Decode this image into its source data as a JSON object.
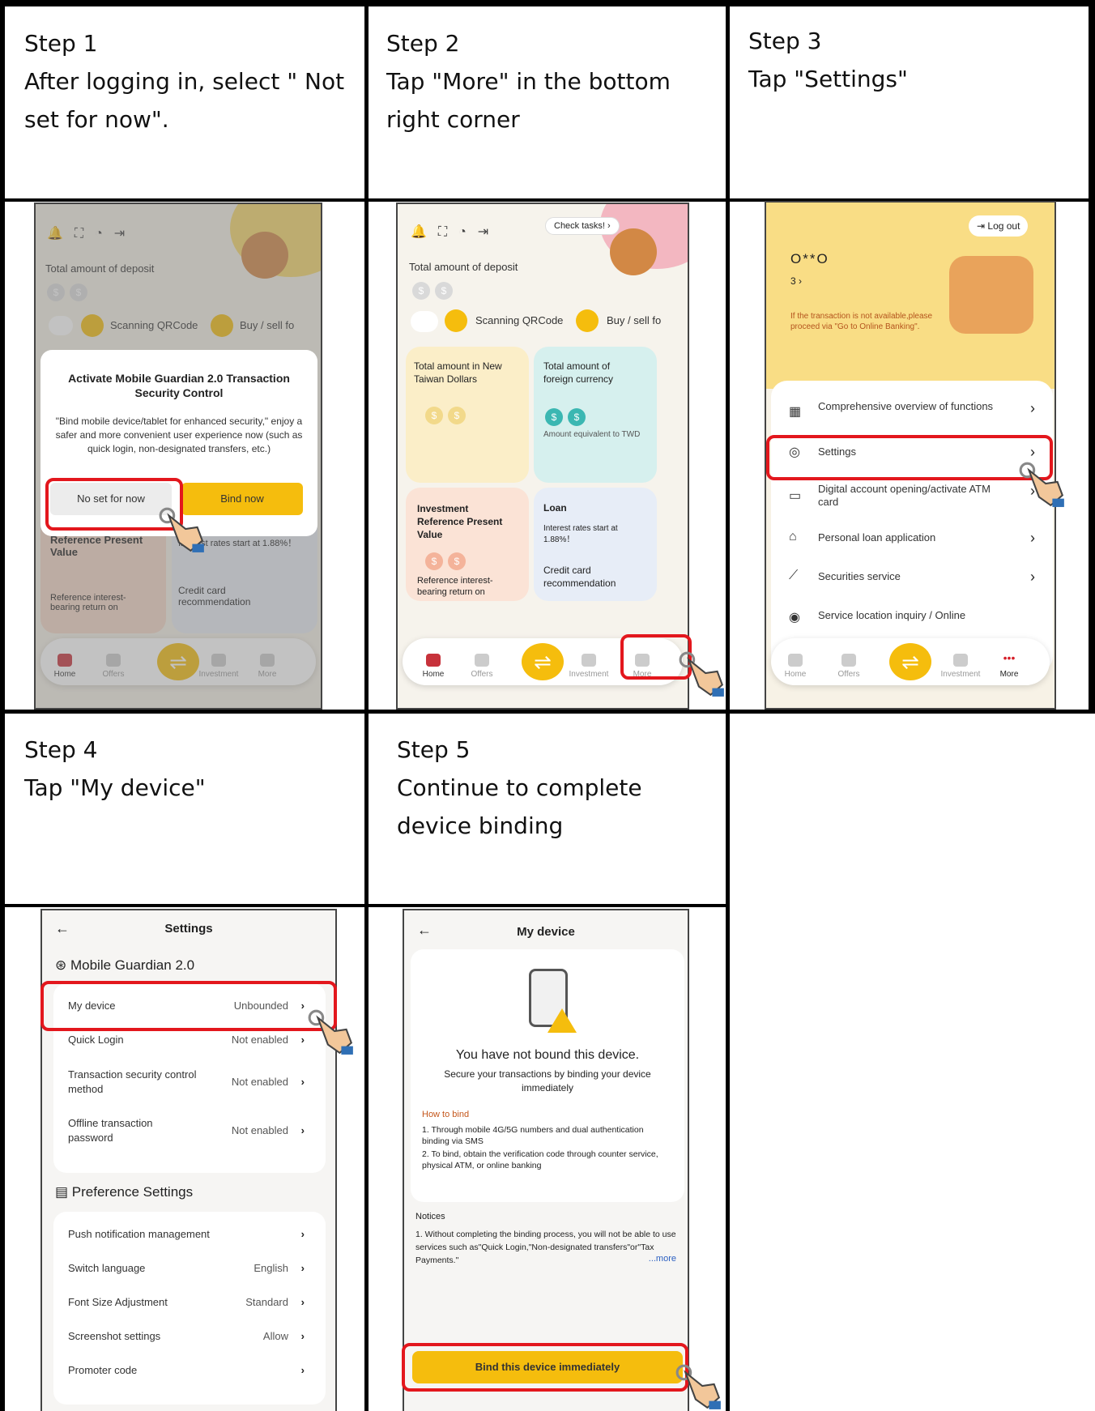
{
  "steps": [
    {
      "title": "Step 1",
      "desc": "After logging in, select \" Not set for now\"."
    },
    {
      "title": "Step 2",
      "desc": "Tap \"More\" in the bottom right corner"
    },
    {
      "title": "Step 3",
      "desc": "Tap \"Settings\""
    },
    {
      "title": "Step 4",
      "desc": "Tap \"My device\""
    },
    {
      "title": "Step 5",
      "desc": "Continue to complete device binding"
    }
  ],
  "home": {
    "deposit_label": "Total amount of deposit",
    "scan_label": "Scanning QRCode",
    "buysell_label": "Buy / sell fo",
    "check_tasks": "Check tasks! ›",
    "card_twd": "Total amount in New Taiwan Dollars",
    "card_foreign": "Total amount of foreign currency",
    "card_foreign_sub": "Amount equivalent to TWD",
    "card_invest": "Investment Reference Present Value",
    "card_invest_sub": "Reference interest-bearing return on",
    "card_loan": "Loan",
    "card_loan_sub": "Interest rates start at 1.88%！",
    "card_credit": "Credit card recommendation",
    "nav": {
      "home": "Home",
      "offers": "Offers",
      "investment": "Investment",
      "more": "More"
    }
  },
  "dialog": {
    "title": "Activate Mobile Guardian 2.0 Transaction Security Control",
    "body": "\"Bind mobile device/tablet for enhanced security,\" enjoy a safer and more convenient user experience now (such as quick login, non-designated transfers, etc.)",
    "no_label": "No set for now",
    "bind_label": "Bind now"
  },
  "more": {
    "logout": "Log out",
    "username": "O**O",
    "coin_count": "3 ›",
    "notice": "If the transaction is not available,please proceed via \"Go to Online Banking\".",
    "items": [
      {
        "label": "Comprehensive overview of functions"
      },
      {
        "label": "Settings"
      },
      {
        "label": "Digital account opening/activate ATM card"
      },
      {
        "label": "Personal loan application"
      },
      {
        "label": "Securities service"
      },
      {
        "label": "Service location inquiry / Online"
      }
    ]
  },
  "settings": {
    "title": "Settings",
    "section1": "Mobile Guardian 2.0",
    "section2": "Preference Settings",
    "rows1": [
      {
        "label": "My device",
        "value": "Unbounded"
      },
      {
        "label": "Quick Login",
        "value": "Not enabled"
      },
      {
        "label": "Transaction security control method",
        "value": "Not enabled"
      },
      {
        "label": "Offline transaction password",
        "value": "Not enabled"
      }
    ],
    "rows2": [
      {
        "label": "Push notification management",
        "value": ""
      },
      {
        "label": "Switch language",
        "value": "English"
      },
      {
        "label": "Font Size Adjustment",
        "value": "Standard"
      },
      {
        "label": "Screenshot settings",
        "value": "Allow"
      },
      {
        "label": "Promoter code",
        "value": ""
      }
    ]
  },
  "device": {
    "title": "My device",
    "headline": "You have not bound this device.",
    "sub": "Secure your transactions by binding your device immediately",
    "how_title": "How to bind",
    "how1": "1.  Through mobile 4G/5G numbers and dual authentication binding via SMS",
    "how2": "2.  To bind, obtain the verification code through counter service, physical ATM, or online banking",
    "notices_title": "Notices",
    "notice1": "1.  Without completing the binding process, you will not be able to use services such as\"Quick Login,\"Non-designated transfers\"or\"Tax Payments.\"",
    "more_link": "...more",
    "button": "Bind this device immediately"
  },
  "colors": {
    "highlight": "#e3171d",
    "accent": "#f5bd0d",
    "more_red": "#d6202a"
  }
}
